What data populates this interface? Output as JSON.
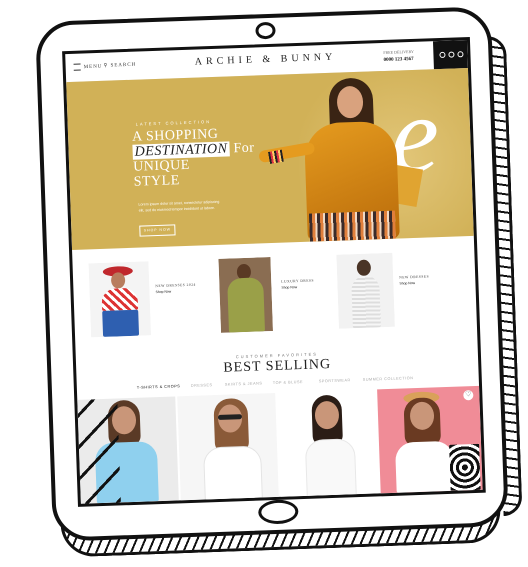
{
  "site": {
    "brand": "ARCHIE & BUNNY",
    "menu_label": "MENU",
    "search_label": "SEARCH",
    "phone": "0000 123 4567",
    "contact_caption": "FREE DELIVERY"
  },
  "hero": {
    "eyebrow": "LATEST COLLECTION",
    "line1": "A SHOPPING",
    "line2_highlight": "DESTINATION",
    "line2_rest": " For",
    "line3": "UNIQUE",
    "line4": "STYLE",
    "description": "Lorem ipsum dolor sit amet, consectetur adipiscing elit, sed do eiusmod tempor incididunt ut labore.",
    "button_label": "SHOP NOW",
    "script_letter": "e"
  },
  "categories": [
    {
      "name": "NEW DRESSES 2024",
      "link": "Shop Now"
    },
    {
      "name": "LUXURY DRESS",
      "link": "Shop Now"
    },
    {
      "name": "NEW DRESSES",
      "link": "Shop Now"
    }
  ],
  "best_selling": {
    "eyebrow": "CUSTOMER FAVORITES",
    "title": "BEST SELLING",
    "tabs": [
      "T-SHIRTS & CROPS",
      "DRESSES",
      "SKIRTS & JEANS",
      "TOP & BLUSE",
      "SPORTSWEAR",
      "SUMMER COLLECTION"
    ],
    "active_tab": "T-SHIRTS & CROPS"
  },
  "colors": {
    "hero_bg": "#d1b157",
    "accent_dark": "#111111",
    "product_pink": "#f08c97"
  }
}
